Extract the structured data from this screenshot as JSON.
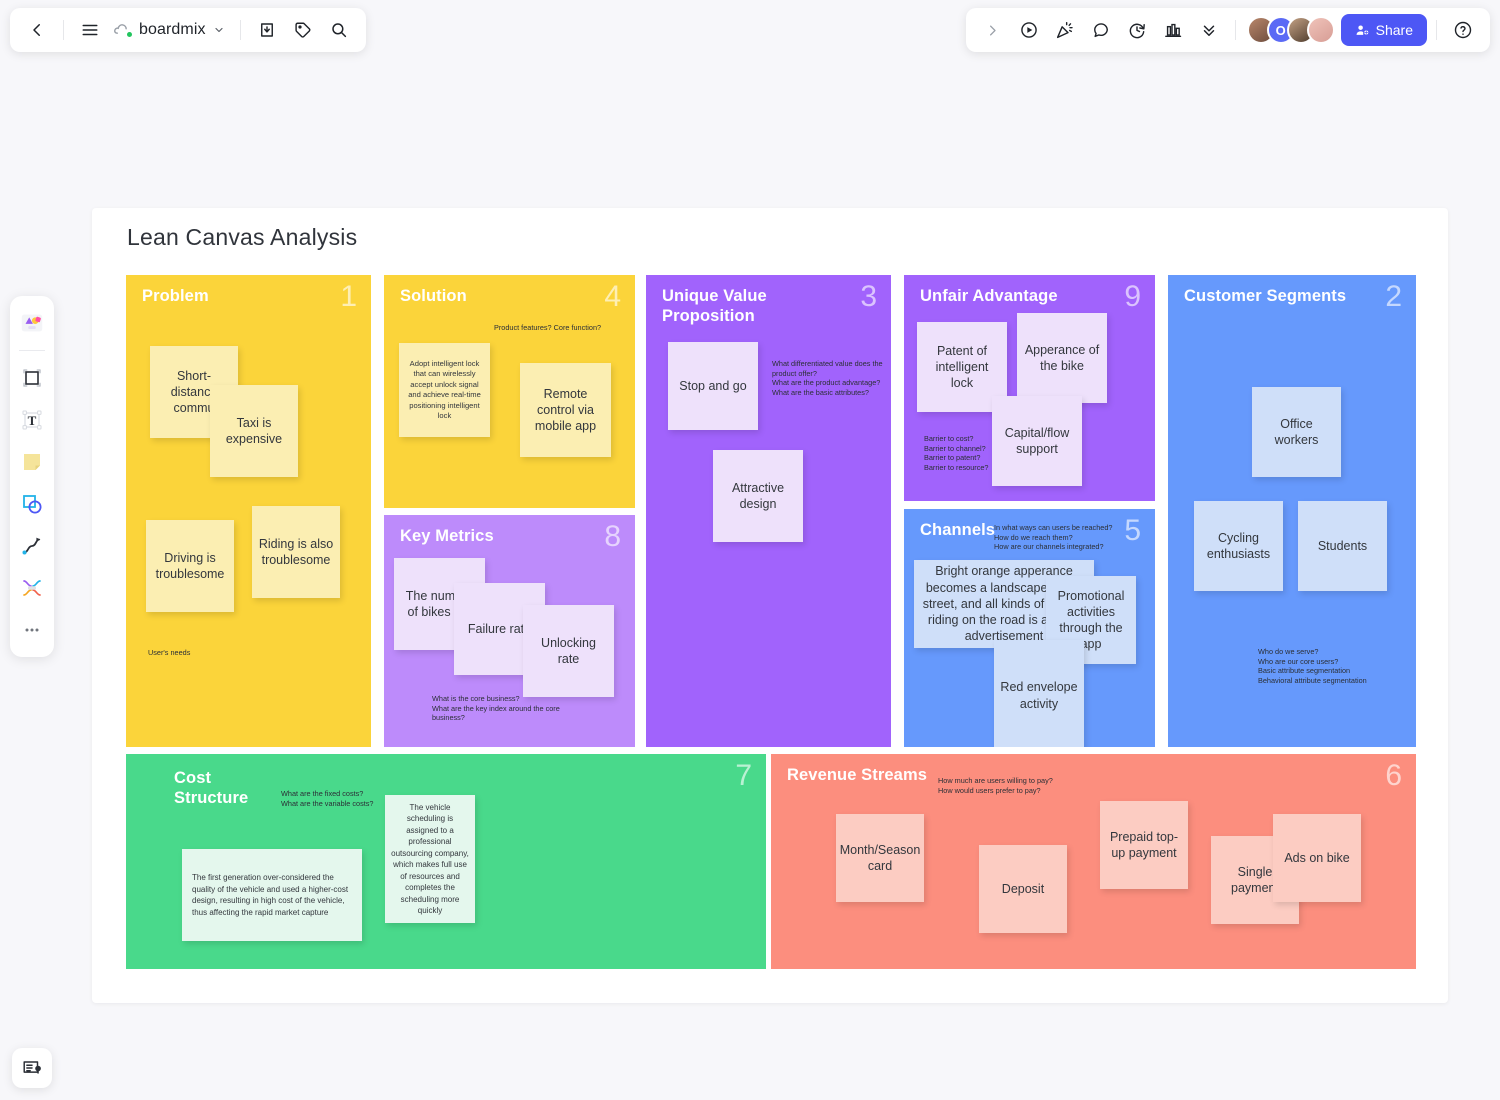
{
  "topbar": {
    "left": {
      "back_label": "back",
      "menu_label": "menu",
      "brand_name": "boardmix",
      "chevron_label": "expand",
      "import_label": "import",
      "tag_label": "tag",
      "search_label": "search"
    },
    "right": {
      "expand_label": "expand-panel",
      "present_label": "present",
      "celebrate_label": "celebrate",
      "comment_label": "comment",
      "timer_label": "timer",
      "chart_label": "chart",
      "more_label": "more",
      "avatar_initial": "O",
      "share_label": "Share",
      "help_label": "help"
    }
  },
  "left_palette": {
    "items": [
      {
        "name": "templates"
      },
      {
        "name": "frame"
      },
      {
        "name": "text"
      },
      {
        "name": "sticky-note"
      },
      {
        "name": "shape"
      },
      {
        "name": "connector"
      },
      {
        "name": "mind-map"
      },
      {
        "name": "more"
      }
    ]
  },
  "bottom_left": {
    "label": "notes-panel"
  },
  "board": {
    "title": "Lean Canvas Analysis",
    "cells": [
      {
        "key": "problem",
        "title": "Problem",
        "number": "1",
        "color": "#fbd43a",
        "hint": "User's needs",
        "notes": [
          {
            "text": "Short-distance commu"
          },
          {
            "text": "Taxi is expensive"
          },
          {
            "text": "Driving is troublesome"
          },
          {
            "text": "Riding is also troublesome"
          }
        ]
      },
      {
        "key": "solution",
        "title": "Solution",
        "number": "4",
        "color": "#fbd43a",
        "hint": "Product features? Core function?",
        "notes": [
          {
            "text": "Adopt intelligent lock that can wirelessly accept unlock signal and achieve real-time positioning intelligent lock"
          },
          {
            "text": "Remote control via mobile app"
          }
        ]
      },
      {
        "key": "key_metrics",
        "title": "Key Metrics",
        "number": "8",
        "color": "#bd8bfb",
        "hint": "What is the core business?\nWhat are the key index around the core business?",
        "notes": [
          {
            "text": "The number of bikes put"
          },
          {
            "text": "Failure rate"
          },
          {
            "text": "Unlocking rate"
          }
        ]
      },
      {
        "key": "uvp",
        "title": "Unique Value Proposition",
        "number": "3",
        "color": "#a163fc",
        "hint": "What differentiated value does the product offer?\nWhat are the product advantage?\nWhat are the basic attributes?",
        "notes": [
          {
            "text": "Stop and go"
          },
          {
            "text": "Attractive design"
          }
        ]
      },
      {
        "key": "unfair_advantage",
        "title": "Unfair Advantage",
        "number": "9",
        "color": "#a163fc",
        "hint": "Barrier to cost?\nBarrier to channel?\nBarrier to patent?\nBarrier to resource?",
        "notes": [
          {
            "text": "Patent of intelligent lock"
          },
          {
            "text": "Apperance of the bike"
          },
          {
            "text": "Capital/flow support"
          }
        ]
      },
      {
        "key": "channels",
        "title": "Channels",
        "number": "5",
        "color": "#6699fc",
        "hint": "In what ways can users be reached?\nHow do we reach them?\nHow are our channels integrated?",
        "notes": [
          {
            "text": "Bright orange apperance becomes a landscape of the street, and all kinds of people riding on the road is a living advertisement"
          },
          {
            "text": "Promotional activities through the app"
          },
          {
            "text": "Red envelope activity"
          }
        ]
      },
      {
        "key": "customer_segments",
        "title": "Customer Segments",
        "number": "2",
        "color": "#6699fc",
        "hint": "Who do we serve?\nWho are our core users?\nBasic attribute segmentation\nBehavioral attribute segmentation",
        "notes": [
          {
            "text": "Office workers"
          },
          {
            "text": "Cycling enthusiasts"
          },
          {
            "text": "Students"
          }
        ]
      },
      {
        "key": "cost_structure",
        "title": "Cost Structure",
        "number": "7",
        "color": "#49d98b",
        "hint": "What are the fixed costs?\nWhat are the variable costs?",
        "notes": [
          {
            "text": "The first generation over-considered the quality of the vehicle and used a higher-cost design, resulting in high cost of the vehicle, thus affecting the rapid market capture"
          },
          {
            "text": "The vehicle scheduling is assigned to a professional outsourcing company, which makes full use of resources and completes the scheduling more quickly"
          }
        ]
      },
      {
        "key": "revenue_streams",
        "title": "Revenue Streams",
        "number": "6",
        "color": "#fc8e7e",
        "hint": "How much are users willing to pay?\nHow would users prefer to pay?",
        "notes": [
          {
            "text": "Month/Season card"
          },
          {
            "text": "Deposit"
          },
          {
            "text": "Prepaid top-up payment"
          },
          {
            "text": "Single payment"
          },
          {
            "text": "Ads on bike"
          }
        ]
      }
    ]
  }
}
